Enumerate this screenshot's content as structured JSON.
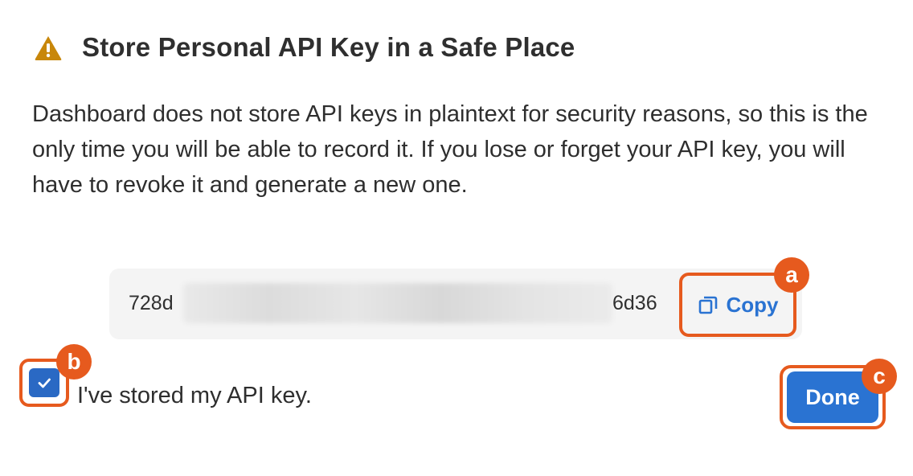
{
  "dialog": {
    "title": "Store Personal API Key in a Safe Place",
    "description": "Dashboard does not store API keys in plaintext for security reasons, so this is the only time you will be able to record it. If you lose or forget your API key, you will have to revoke it and generate a new one.",
    "warning_icon": "warning-triangle-icon",
    "colors": {
      "warning": "#c8870a",
      "accent": "#2a73d2",
      "highlight": "#e65a1e"
    }
  },
  "api_key": {
    "prefix": "728d",
    "suffix": "6d36",
    "copy_label": "Copy",
    "copy_icon": "copy-icon"
  },
  "confirm": {
    "checkbox_label": "I've stored my API key.",
    "checked": true
  },
  "actions": {
    "done_label": "Done"
  },
  "callouts": {
    "a": "a",
    "b": "b",
    "c": "c"
  }
}
